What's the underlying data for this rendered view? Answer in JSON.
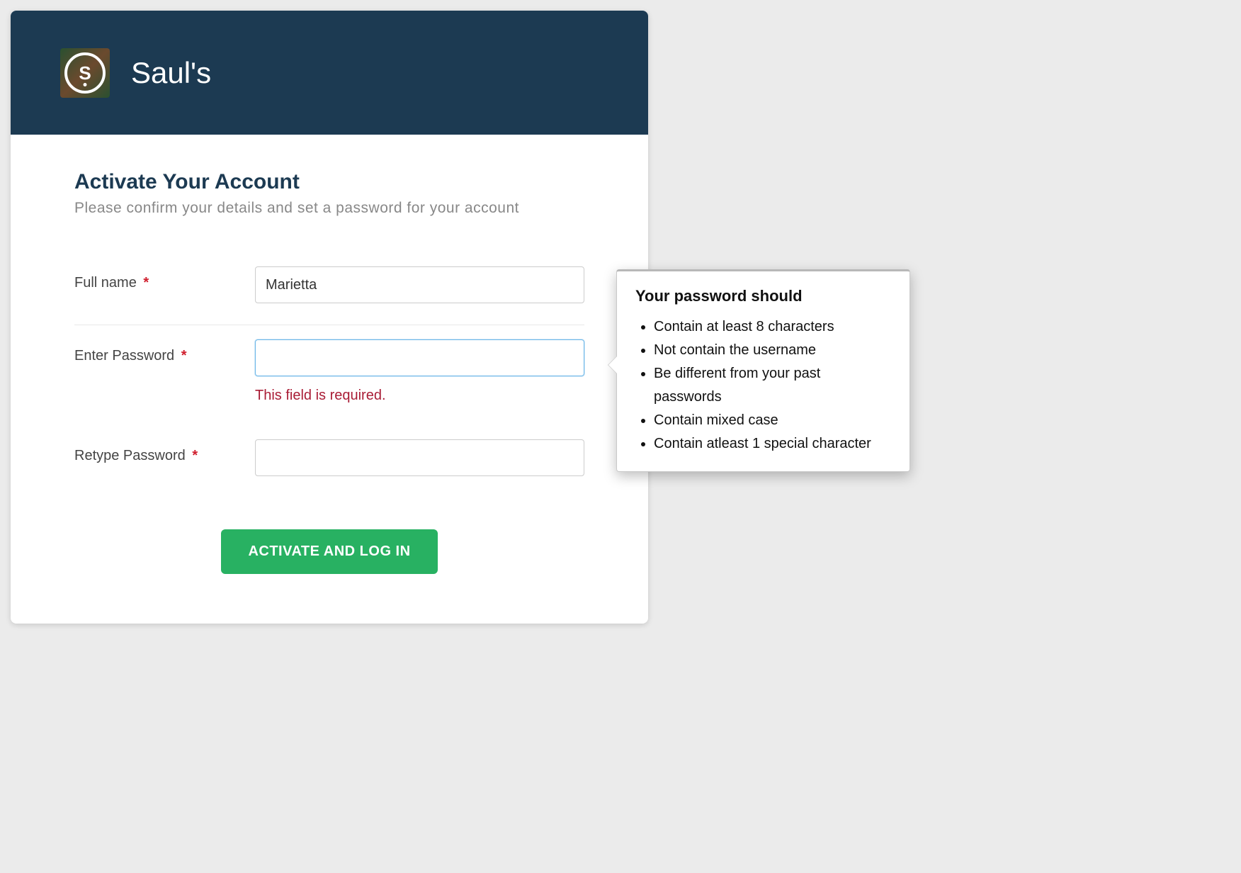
{
  "header": {
    "logo_letter": "S",
    "brand_name": "Saul's"
  },
  "page": {
    "title": "Activate Your Account",
    "subtitle": "Please confirm your details and set a password for your account"
  },
  "form": {
    "full_name": {
      "label": "Full name",
      "required_marker": "*",
      "value": "Marietta"
    },
    "password": {
      "label": "Enter Password",
      "required_marker": "*",
      "value": "",
      "error": "This field is required."
    },
    "retype_password": {
      "label": "Retype Password",
      "required_marker": "*",
      "value": ""
    },
    "submit_label": "ACTIVATE AND LOG IN"
  },
  "tooltip": {
    "title": "Your password should",
    "rules": [
      "Contain at least 8 characters",
      "Not contain the username",
      "Be different from your past passwords",
      "Contain mixed case",
      "Contain atleast 1 special character"
    ]
  },
  "colors": {
    "header_bg": "#1c3a52",
    "accent_green": "#28b162",
    "error_red": "#a91d36"
  }
}
